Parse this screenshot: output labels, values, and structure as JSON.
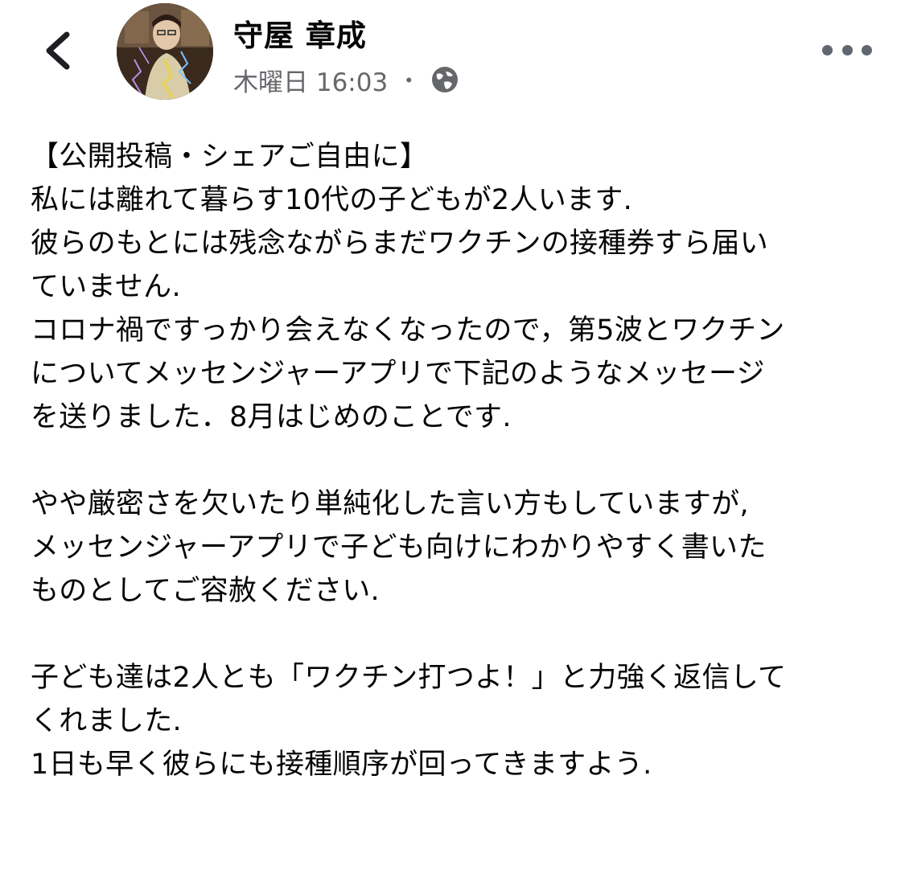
{
  "header": {
    "author_name": "守屋 章成",
    "timestamp": "木曜日 16:03",
    "separator": "・",
    "back_icon": "chevron-left-icon",
    "privacy_icon": "globe-icon",
    "more_icon": "more-dots-icon"
  },
  "post": {
    "lines": [
      "【公開投稿・シェアご自由に】",
      "私には離れて暮らす10代の子どもが2人います.",
      "彼らのもとには残念ながらまだワクチンの接種券すら届い",
      "ていません.",
      "コロナ禍ですっかり会えなくなったので，第5波とワクチン",
      "についてメッセンジャーアプリで下記のようなメッセージ",
      "を送りました．8月はじめのことです.",
      "",
      "やや厳密さを欠いたり単純化した言い方もしていますが,",
      "メッセンジャーアプリで子ども向けにわかりやすく書いた",
      "ものとしてご容赦ください.",
      "",
      "子ども達は2人とも「ワクチン打つよ！」と力強く返信して",
      "くれました.",
      "1日も早く彼らにも接種順序が回ってきますよう."
    ]
  },
  "colors": {
    "text_primary": "#050505",
    "text_secondary": "#65676b",
    "icon": "#606770",
    "background": "#ffffff"
  }
}
